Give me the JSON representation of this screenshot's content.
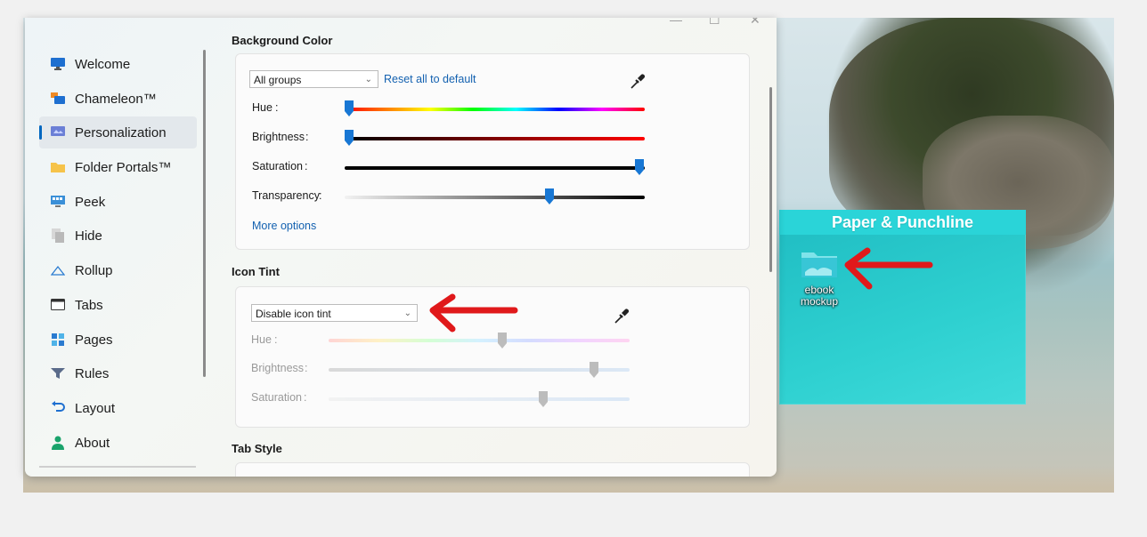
{
  "window": {
    "controls": {
      "minimize": "—",
      "maximize": "☐",
      "close": "✕"
    }
  },
  "sidebar": {
    "items": [
      {
        "label": "Welcome",
        "icon": "monitor-icon"
      },
      {
        "label": "Chameleon™",
        "icon": "chameleon-icon"
      },
      {
        "label": "Personalization",
        "icon": "personalization-icon",
        "active": true
      },
      {
        "label": "Folder Portals™",
        "icon": "folder-icon"
      },
      {
        "label": "Peek",
        "icon": "peek-icon"
      },
      {
        "label": "Hide",
        "icon": "hide-icon"
      },
      {
        "label": "Rollup",
        "icon": "rollup-icon"
      },
      {
        "label": "Tabs",
        "icon": "tabs-icon"
      },
      {
        "label": "Pages",
        "icon": "pages-icon"
      },
      {
        "label": "Rules",
        "icon": "rules-icon"
      },
      {
        "label": "Layout",
        "icon": "layout-icon"
      },
      {
        "label": "About",
        "icon": "about-icon"
      }
    ]
  },
  "background_color": {
    "title": "Background Color",
    "group_select": "All groups",
    "reset_link": "Reset all to default",
    "sliders": [
      {
        "label": "Hue",
        "value": 0.0
      },
      {
        "label": "Brightness",
        "value": 0.0
      },
      {
        "label": "Saturation",
        "value": 1.0
      },
      {
        "label": "Transparency",
        "value": 0.68
      }
    ],
    "more_options": "More options"
  },
  "icon_tint": {
    "title": "Icon Tint",
    "select": "Disable icon tint",
    "sliders": [
      {
        "label": "Hue",
        "value": 0.58
      },
      {
        "label": "Brightness",
        "value": 0.88
      },
      {
        "label": "Saturation",
        "value": 0.71
      }
    ]
  },
  "tab_style": {
    "title": "Tab Style"
  },
  "fence": {
    "title": "Paper & Punchline",
    "icon_label_line1": "ebook",
    "icon_label_line2": "mockup"
  },
  "colors": {
    "accent": "#0067c0",
    "link": "#1361b0",
    "fence": "#2ad4d8",
    "annotation_arrow": "#e0191b"
  }
}
